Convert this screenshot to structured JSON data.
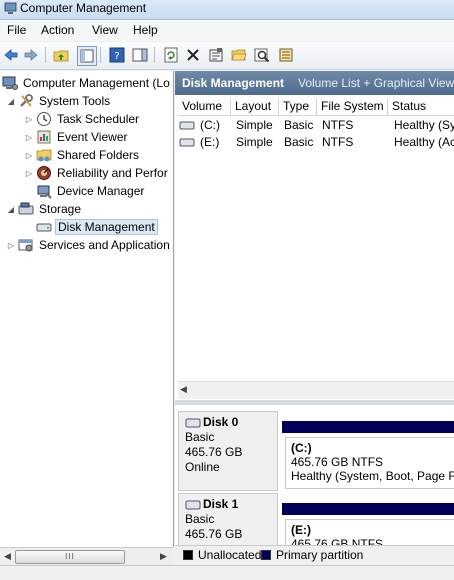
{
  "window": {
    "title": "Computer Management"
  },
  "menu": [
    "File",
    "Action",
    "View",
    "Help"
  ],
  "toolbar": {
    "buttons": [
      "back-icon",
      "forward-icon",
      "up-folder-icon",
      "show-hide-tree-icon",
      "help-icon",
      "show-action-pane-icon",
      "refresh-icon",
      "delete-icon",
      "properties-icon",
      "open-icon",
      "search-icon",
      "export-icon"
    ]
  },
  "tree": {
    "root": "Computer Management (Lo",
    "system_tools": "System Tools",
    "task_scheduler": "Task Scheduler",
    "event_viewer": "Event Viewer",
    "shared_folders": "Shared Folders",
    "reliability": "Reliability and Perfor",
    "device_manager": "Device Manager",
    "storage": "Storage",
    "disk_management": "Disk Management",
    "services": "Services and Application",
    "scroll_grip": "III"
  },
  "panel": {
    "title": "Disk Management",
    "subtitle": "Volume List + Graphical View"
  },
  "volume_list": {
    "columns": [
      "Volume",
      "Layout",
      "Type",
      "File System",
      "Status"
    ],
    "rows": [
      {
        "volume": "(C:)",
        "layout": "Simple",
        "type": "Basic",
        "fs": "NTFS",
        "status": "Healthy (Sy"
      },
      {
        "volume": "(E:)",
        "layout": "Simple",
        "type": "Basic",
        "fs": "NTFS",
        "status": "Healthy (Ac"
      }
    ]
  },
  "disks": [
    {
      "name": "Disk 0",
      "kind": "Basic",
      "size": "465.76 GB",
      "state": "Online",
      "part_label": "(C:)",
      "part_size": "465.76 GB NTFS",
      "part_status": "Healthy (System, Boot, Page Fil"
    },
    {
      "name": "Disk 1",
      "kind": "Basic",
      "size": "465.76 GB",
      "state": "",
      "part_label": "(E:)",
      "part_size": "465.76 GB NTFS",
      "part_status": ""
    }
  ],
  "legend": [
    {
      "label": "Unallocated",
      "color": "#000000"
    },
    {
      "label": "Primary partition",
      "color": "#00005a"
    }
  ],
  "colors": {
    "header_bar": "#5a7699",
    "primary_partition": "#00005a",
    "selection": "#dde8f5"
  }
}
